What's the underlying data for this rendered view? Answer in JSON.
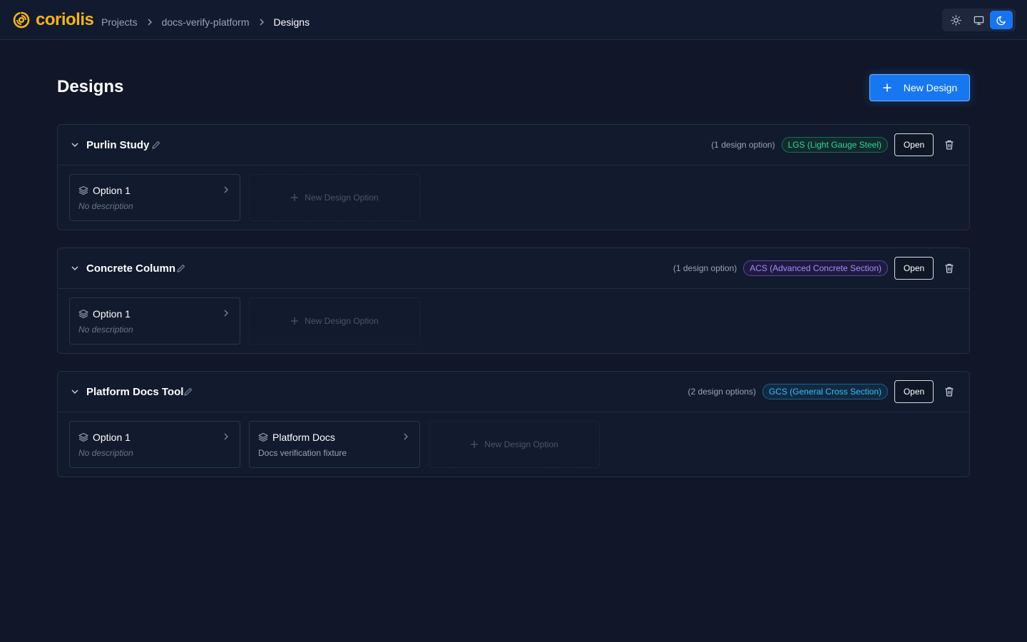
{
  "app": {
    "name": "coriolis"
  },
  "breadcrumbs": [
    "Projects",
    "docs-verify-platform",
    "Designs"
  ],
  "theme": {
    "options": [
      "light",
      "system",
      "dark"
    ],
    "selected": "dark"
  },
  "page": {
    "title": "Designs",
    "new_design_label": "New Design"
  },
  "designs": [
    {
      "name": "Purlin Study",
      "count_label": "(1 design option)",
      "tag": "LGS (Light Gauge Steel)",
      "tag_color": "#34d399",
      "open_label": "Open",
      "options": [
        {
          "name": "Option 1",
          "description": "No description"
        }
      ],
      "new_option_label": "New Design Option"
    },
    {
      "name": "Concrete Column",
      "count_label": "(1 design option)",
      "tag": "ACS (Advanced Concrete Section)",
      "tag_color": "#a78bfa",
      "open_label": "Open",
      "options": [
        {
          "name": "Option 1",
          "description": "No description"
        }
      ],
      "new_option_label": "New Design Option"
    },
    {
      "name": "Platform Docs Tool",
      "count_label": "(2 design options)",
      "tag": "GCS (General Cross Section)",
      "tag_color": "#38bdf8",
      "open_label": "Open",
      "options": [
        {
          "name": "Option 1",
          "description": "No description"
        },
        {
          "name": "Platform Docs",
          "description": "Docs verification fixture"
        }
      ],
      "new_option_label": "New Design Option"
    }
  ],
  "colors": {
    "accent": "#1677f0",
    "brand": "#f4b41a",
    "background": "#111729"
  }
}
